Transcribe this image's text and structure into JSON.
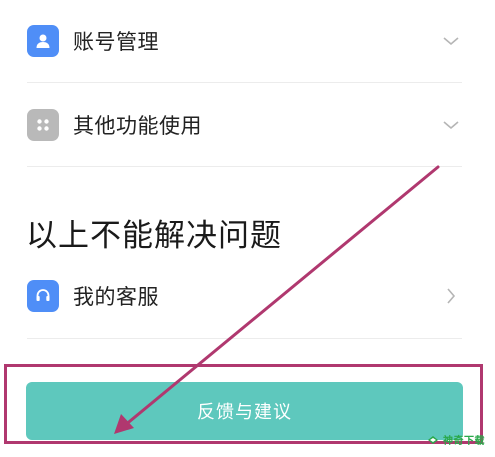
{
  "colors": {
    "account_icon_bg": "#4f8ef7",
    "other_icon_bg": "#b9b9b9",
    "service_icon_bg": "#4f8ef7",
    "feedback_button_bg": "#5ec8bd",
    "annotation": "#b0386f",
    "watermark": "#2aa84a"
  },
  "faq": {
    "items": [
      {
        "label": "账号管理",
        "icon": "user-icon",
        "chevron": "chevron-down-icon"
      },
      {
        "label": "其他功能使用",
        "icon": "grid-icon",
        "chevron": "chevron-down-icon"
      }
    ]
  },
  "help_section": {
    "title": "以上不能解决问题",
    "service_label": "我的客服",
    "service_icon": "headset-icon",
    "service_chevron": "chevron-right-icon"
  },
  "feedback_button": {
    "label": "反馈与建议"
  },
  "watermark": {
    "text": "神奇下载"
  }
}
